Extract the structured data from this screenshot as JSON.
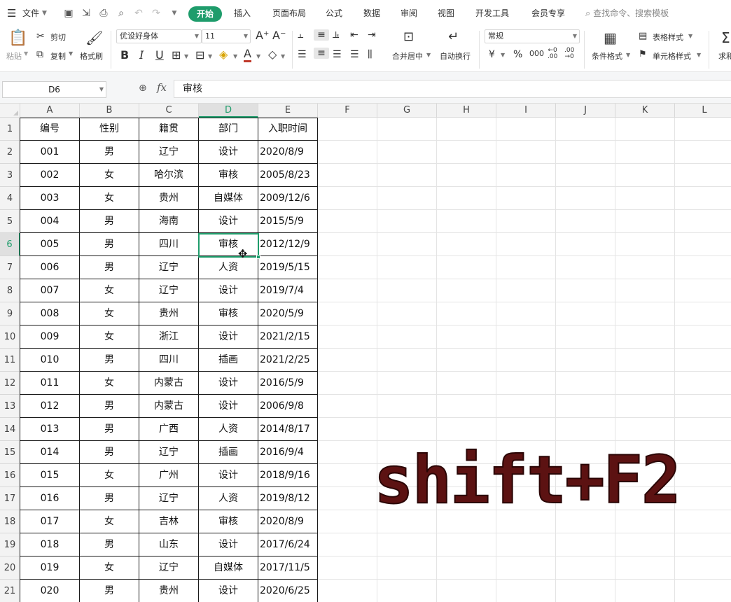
{
  "menubar": {
    "file_label": "文件",
    "tabs": [
      "开始",
      "插入",
      "页面布局",
      "公式",
      "数据",
      "审阅",
      "视图",
      "开发工具",
      "会员专享"
    ],
    "active_tab": "开始",
    "search_placeholder": "查找命令、搜索模板"
  },
  "ribbon": {
    "paste": "粘贴",
    "cut": "剪切",
    "copy": "复制",
    "format_painter": "格式刷",
    "font_name": "优设好身体",
    "font_size": "11",
    "bold": "B",
    "italic": "I",
    "underline": "U",
    "merge_center": "合并居中",
    "wrap_text": "自动换行",
    "number_format": "常规",
    "table_style": "表格样式",
    "cell_style": "单元格样式",
    "conditional_format": "条件格式",
    "sum": "求和"
  },
  "formula_bar": {
    "name_box": "D6",
    "fx": "fx",
    "content": "审核"
  },
  "columns": [
    "A",
    "B",
    "C",
    "D",
    "E",
    "F",
    "G",
    "H",
    "I",
    "J",
    "K",
    "L"
  ],
  "row_numbers": [
    "1",
    "2",
    "3",
    "4",
    "5",
    "6",
    "7",
    "8",
    "9",
    "10",
    "11",
    "12",
    "13",
    "14",
    "15",
    "16",
    "17",
    "18",
    "19",
    "20",
    "21"
  ],
  "selected_column": "D",
  "selected_row": "6",
  "table": {
    "headers": [
      "编号",
      "性别",
      "籍贯",
      "部门",
      "入职时间"
    ],
    "rows": [
      [
        "001",
        "男",
        "辽宁",
        "设计",
        "2020/8/9"
      ],
      [
        "002",
        "女",
        "哈尔滨",
        "审核",
        "2005/8/23"
      ],
      [
        "003",
        "女",
        "贵州",
        "自媒体",
        "2009/12/6"
      ],
      [
        "004",
        "男",
        "海南",
        "设计",
        "2015/5/9"
      ],
      [
        "005",
        "男",
        "四川",
        "审核",
        "2012/12/9"
      ],
      [
        "006",
        "男",
        "辽宁",
        "人资",
        "2019/5/15"
      ],
      [
        "007",
        "女",
        "辽宁",
        "设计",
        "2019/7/4"
      ],
      [
        "008",
        "女",
        "贵州",
        "审核",
        "2020/5/9"
      ],
      [
        "009",
        "女",
        "浙江",
        "设计",
        "2021/2/15"
      ],
      [
        "010",
        "男",
        "四川",
        "插画",
        "2021/2/25"
      ],
      [
        "011",
        "女",
        "内蒙古",
        "设计",
        "2016/5/9"
      ],
      [
        "012",
        "男",
        "内蒙古",
        "设计",
        "2006/9/8"
      ],
      [
        "013",
        "男",
        "广西",
        "人资",
        "2014/8/17"
      ],
      [
        "014",
        "男",
        "辽宁",
        "插画",
        "2016/9/4"
      ],
      [
        "015",
        "女",
        "广州",
        "设计",
        "2018/9/16"
      ],
      [
        "016",
        "男",
        "辽宁",
        "人资",
        "2019/8/12"
      ],
      [
        "017",
        "女",
        "吉林",
        "审核",
        "2020/8/9"
      ],
      [
        "018",
        "男",
        "山东",
        "设计",
        "2017/6/24"
      ],
      [
        "019",
        "女",
        "辽宁",
        "自媒体",
        "2017/11/5"
      ],
      [
        "020",
        "男",
        "贵州",
        "设计",
        "2020/6/25"
      ]
    ]
  },
  "overlay": {
    "shortcut": "shift+F2"
  },
  "colors": {
    "accent": "#1e9c6b",
    "overlay_text": "#5c1212"
  }
}
